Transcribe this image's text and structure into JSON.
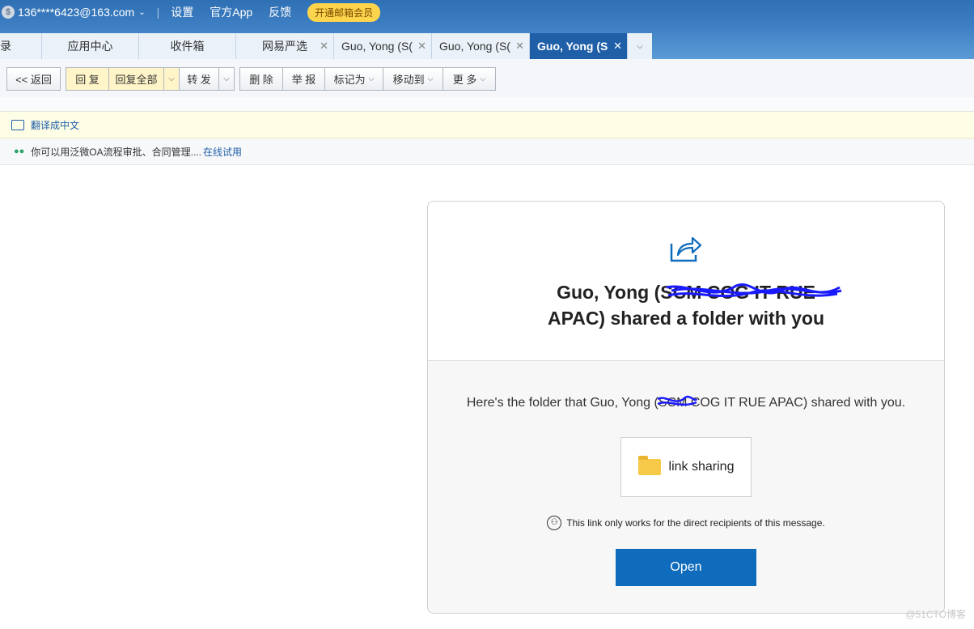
{
  "account": {
    "icon": "coin-icon",
    "email": "136****6423@163.com",
    "links": [
      "设置",
      "官方App",
      "反馈"
    ],
    "vip_button": "开通邮箱会员"
  },
  "tabs": [
    {
      "label": "录",
      "closable": false,
      "active": false
    },
    {
      "label": "应用中心",
      "closable": false,
      "active": false
    },
    {
      "label": "收件箱",
      "closable": false,
      "active": false
    },
    {
      "label": "网易严选",
      "closable": true,
      "active": false
    },
    {
      "label": "Guo, Yong (S(",
      "closable": true,
      "active": false
    },
    {
      "label": "Guo, Yong (S(",
      "closable": true,
      "active": false
    },
    {
      "label": "Guo, Yong (S",
      "closable": true,
      "active": true
    }
  ],
  "toolbar": {
    "back": "<< 返回",
    "reply": "回 复",
    "reply_all": "回复全部",
    "forward": "转 发",
    "delete": "删 除",
    "report": "举 报",
    "mark_as": "标记为",
    "move_to": "移动到",
    "more": "更 多"
  },
  "translate_bar": {
    "label": "翻译成中文"
  },
  "ad_bar": {
    "text": "你可以用泛微OA流程审批、合同管理....",
    "link": "在线试用"
  },
  "email": {
    "headline_line1": "Guo, Yong (SCM COG IT RUE",
    "headline_line2": "APAC) shared a folder with you",
    "message_prefix": "Here's the folder that Guo, Yong (",
    "message_redacted": "SCM",
    "message_suffix": " COG IT RUE APAC) shared with you.",
    "folder_name": "link sharing",
    "notice": "This link only works for the direct recipients of this message.",
    "open_button": "Open"
  },
  "watermark": "@51CTO博客",
  "colors": {
    "accent": "#0f6cbd",
    "topbar": "#3d7ec2",
    "scribble": "#1a1aff"
  }
}
